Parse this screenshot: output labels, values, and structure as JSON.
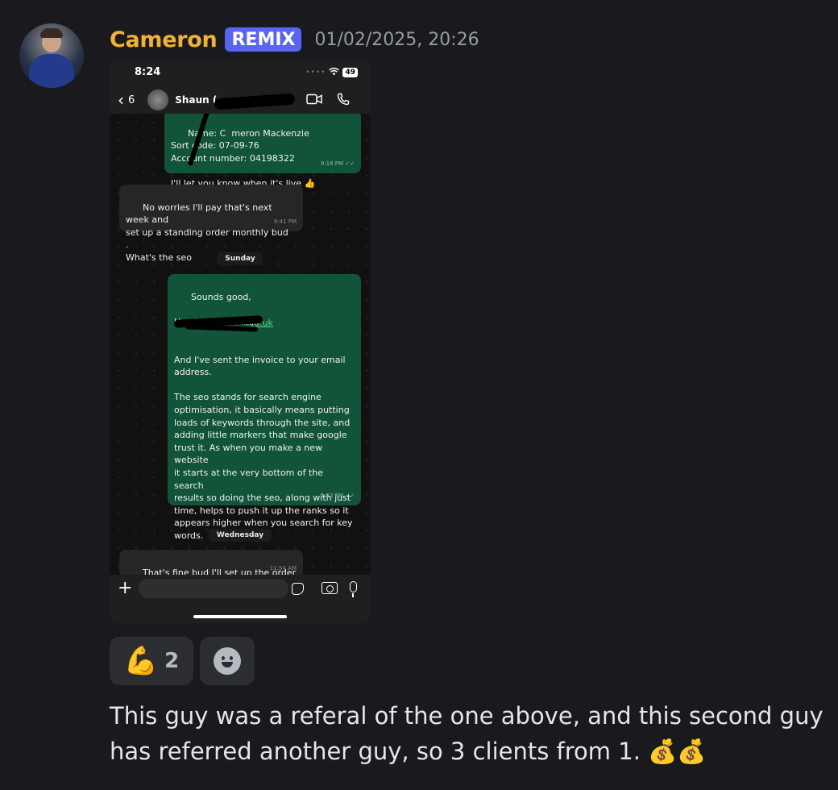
{
  "author": {
    "name": "Cameron",
    "tag": "REMIX",
    "timestamp": "01/02/2025, 20:26"
  },
  "phone": {
    "status_time": "8:24",
    "battery": "49",
    "back_count": "6",
    "contact_name": "Shaun (           Ma...",
    "messages": [
      {
        "text": "Name: C  meron Mackenzie\nSort code: 07-09-76\nAccount number: 04198322\n\nI'll let you know when it's live 👍",
        "time": "9:18 PM ✓✓"
      },
      {
        "text": "No worries I'll pay that's next week and\nset up a standing order monthly bud  .\nWhat's the seo",
        "time": "9:41 PM"
      },
      {
        "text": "Sounds good,\n\nHere's the live link:\n \n\nAnd I've sent the invoice to your email\naddress.\n\nThe seo stands for search engine\noptimisation, it basically means putting\nloads of keywords through the site, and\nadding little markers that make google\ntrust it. As when you make a new website\nit starts at the very bottom of the search\nresults so doing the seo, along with just\ntime, helps to push it up the ranks so it\nappears higher when you search for key\nwords.",
        "time": "1:22 PM ✓✓",
        "link": ".co.uk"
      },
      {
        "text": "That's fine bud I'll set up the order soon",
        "time": "11:54 AM"
      }
    ],
    "day_labels": [
      "Sunday",
      "Wednesday"
    ]
  },
  "reactions": [
    {
      "emoji": "💪",
      "count": "2"
    }
  ],
  "message_text": "This guy was a referal of the one above, and this second guy has referred another guy, so 3 clients from 1. 💰💰"
}
